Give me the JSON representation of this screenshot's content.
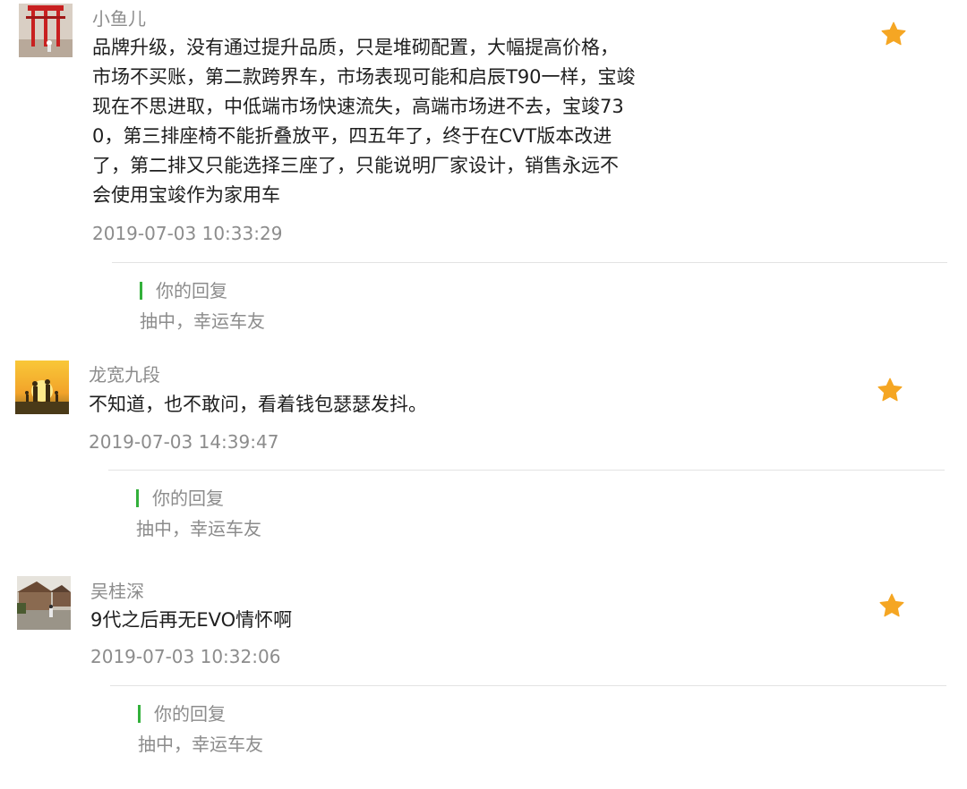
{
  "comments": [
    {
      "username": "小鱼儿",
      "avatar_icon": "user-avatar-red-gate-photo",
      "lines": [
        "品牌升级，没有通过提升品质，只是堆砌配置，大幅提高价格，",
        "市场不买账，第二款跨界车，市场表现可能和启辰T90一样，宝竣",
        "现在不思进取，中低端市场快速流失，高端市场进不去，宝竣73",
        "0，第三排座椅不能折叠放平，四五年了，终于在CVT版本改进",
        "了，第二排又只能选择三座了，只能说明厂家设计，销售永远不",
        "会使用宝竣作为家用车"
      ],
      "timestamp": "2019-07-03 10:33:29",
      "reply_label": "你的回复",
      "reply_text": "抽中，幸运车友",
      "star_color": "#f5a623"
    },
    {
      "username": "龙宽九段",
      "avatar_icon": "user-avatar-sunset-family-photo",
      "lines": [
        "不知道，也不敢问，看着钱包瑟瑟发抖。"
      ],
      "timestamp": "2019-07-03 14:39:47",
      "reply_label": "你的回复",
      "reply_text": "抽中，幸运车友",
      "star_color": "#f5a623"
    },
    {
      "username": "吴桂深",
      "avatar_icon": "user-avatar-street-photo",
      "lines": [
        "9代之后再无EVO情怀啊"
      ],
      "timestamp": "2019-07-03 10:32:06",
      "reply_label": "你的回复",
      "reply_text": "抽中，幸运车友",
      "star_color": "#f5a623"
    }
  ]
}
